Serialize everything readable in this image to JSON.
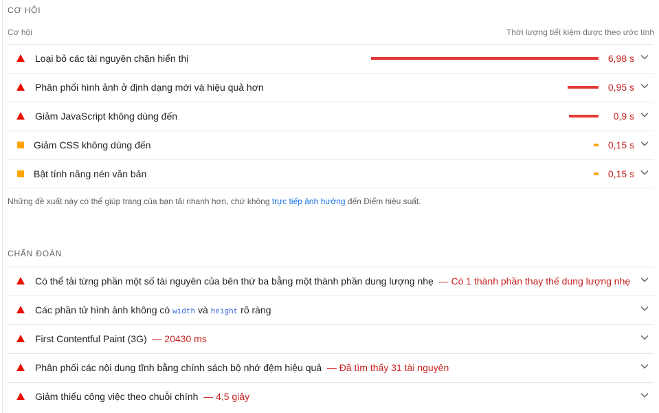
{
  "opportunities": {
    "section_title": "CƠ HỘI",
    "col_left": "Cơ hội",
    "col_right": "Thời lượng tiết kiệm được theo ước tính",
    "items": [
      {
        "title": "Loại bỏ các tài nguyên chặn hiển thị",
        "savings": "6,98 s",
        "level": "fail",
        "icon": "red-triangle-icon",
        "value_s": 6.98
      },
      {
        "title": "Phân phối hình ảnh ở định dạng mới và hiệu quả hơn",
        "savings": "0,95 s",
        "level": "fail",
        "icon": "red-triangle-icon",
        "value_s": 0.95
      },
      {
        "title": "Giảm JavaScript không dùng đến",
        "savings": "0,9 s",
        "level": "fail",
        "icon": "red-triangle-icon",
        "value_s": 0.9
      },
      {
        "title": "Giảm CSS không dùng đến",
        "savings": "0,15 s",
        "level": "average",
        "icon": "orange-square-icon",
        "value_s": 0.15
      },
      {
        "title": "Bật tính năng nén văn bản",
        "savings": "0,15 s",
        "level": "average",
        "icon": "orange-square-icon",
        "value_s": 0.15
      }
    ],
    "note_before": "Những đề xuất này có thể giúp trang của bạn tải nhanh hơn, chứ không ",
    "note_link": "trực tiếp ảnh hưởng",
    "note_after": " đến Điểm hiệu suất."
  },
  "diagnostics": {
    "section_title": "CHẨN ĐOÁN",
    "items": [
      {
        "title": "Có thể tải từng phần một số tài nguyên của bên thứ ba bằng một thành phần dung lượng nhẹ",
        "detail": "— Có 1 thành phần thay thế dung lượng nhẹ"
      },
      {
        "title_before": "Các phần tử hình ảnh không có ",
        "code1": "width",
        "title_mid": " và ",
        "code2": "height",
        "title_after": " rõ ràng"
      },
      {
        "title": "First Contentful Paint (3G)",
        "detail": "— 20430 ms"
      },
      {
        "title": "Phân phối các nội dung tĩnh bằng chính sách bộ nhớ đệm hiệu quả",
        "detail": "— Đã tìm thấy 31 tài nguyên"
      },
      {
        "title": "Giảm thiểu công việc theo chuỗi chính",
        "detail": "— 4,5 giây"
      }
    ]
  },
  "colors": {
    "fail": "#eb0f00",
    "average": "#ffa400",
    "detail_text": "#c5221f",
    "link": "#1a73e8"
  }
}
